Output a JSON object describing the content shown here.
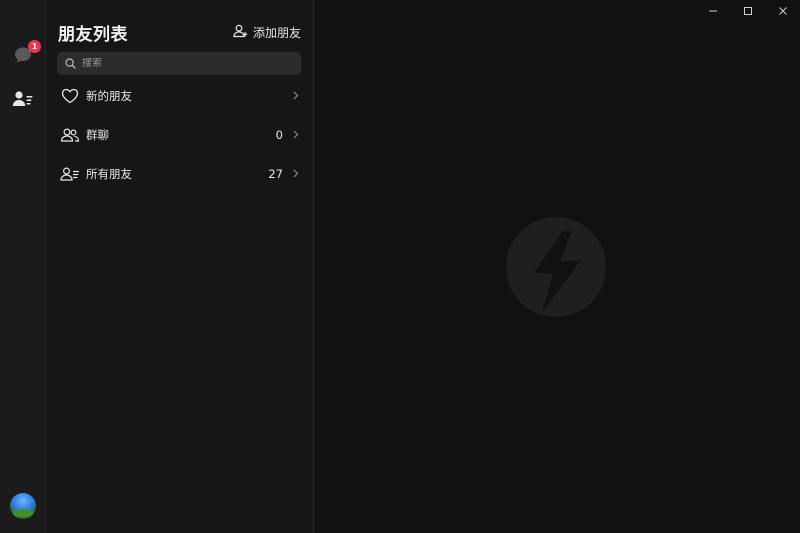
{
  "rail": {
    "chat_badge": "1"
  },
  "panel": {
    "title": "朋友列表",
    "add_friend_label": "添加朋友",
    "search_placeholder": "搜索",
    "items": [
      {
        "label": "新的朋友",
        "count": "",
        "icon": "heart-icon"
      },
      {
        "label": "群聊",
        "count": "0",
        "icon": "group-icon"
      },
      {
        "label": "所有朋友",
        "count": "27",
        "icon": "contacts-list-icon"
      }
    ]
  },
  "window_controls": [
    "minimize-icon",
    "maximize-icon",
    "close-icon"
  ],
  "colors": {
    "background": "#111111",
    "rail": "#1b1b1b",
    "panel": "#161616",
    "search": "#2c2c2c",
    "badge": "#f0334f",
    "logo": "#1f1f1f"
  }
}
